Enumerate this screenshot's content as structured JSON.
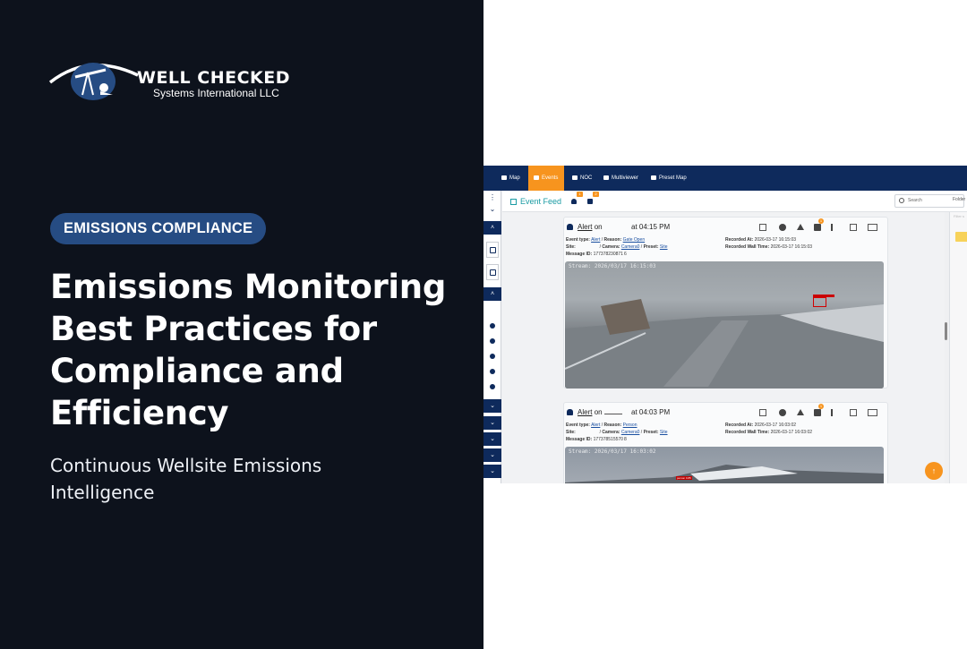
{
  "brand": {
    "name": "WELL CHECKED",
    "subtitle": "Systems International LLC"
  },
  "badge": "EMISSIONS COMPLIANCE",
  "headline": {
    "line1": "Emissions Monitoring",
    "line2": "Best Practices for",
    "line3": "Compliance and",
    "line4": "Efficiency"
  },
  "subline": {
    "line1": "Continuous Wellsite Emissions",
    "line2": "Intelligence"
  },
  "colors": {
    "panel_bg": "#0d121c",
    "badge_bg": "#264c83",
    "app_nav": "#0e2a5c",
    "accent_orange": "#f7941e",
    "feed_teal": "#1a9ba3",
    "detection_red": "#d10000"
  },
  "app": {
    "nav_tabs": [
      {
        "label": "Map",
        "icon": "map-icon",
        "active": false
      },
      {
        "label": "Events",
        "icon": "calendar-icon",
        "active": true
      },
      {
        "label": "NOC",
        "icon": "camera-icon",
        "active": false
      },
      {
        "label": "Multiviewer",
        "icon": "camera-icon",
        "active": false
      },
      {
        "label": "Preset Map",
        "icon": "map-icon",
        "active": false
      }
    ],
    "feed_title": "Event Feed",
    "header_badges": [
      "1",
      "2"
    ],
    "search_placeholder": "Search",
    "folders_label": "Folder",
    "right_panel_hint": "Filter s",
    "scroll_top_icon": "↑",
    "events": [
      {
        "alert_label": "Alert",
        "on_label": "on",
        "time": "at 04:15 PM",
        "event_type": "Alert",
        "reason": "Gate Open",
        "site": "",
        "camera": "Camera0",
        "preset": "Site",
        "message_id": "177378230871 6",
        "recorded_at": "2026-03-17 16:15:03",
        "recorded_wall_time": "2026-03-17 16:15:03",
        "image_timestamp": "Stream: 2026/03/17 16:15:03",
        "notification_count": "1"
      },
      {
        "alert_label": "Alert",
        "on_label": "on",
        "time": "at 04:03 PM",
        "event_type": "Alert",
        "reason": "Person",
        "site": "",
        "camera": "Camera0",
        "preset": "Site",
        "message_id": "177378515570 8",
        "recorded_at": "2026-03-17 16:03:02",
        "recorded_wall_time": "2026-03-17 16:03:02",
        "image_timestamp": "Stream: 2026/03/17 16:03:02",
        "notification_count": "1",
        "detection_label": "person 0.85"
      }
    ],
    "labels": {
      "event_type": "Event type:",
      "reason": "Reason:",
      "site": "Site:",
      "camera": "Camera:",
      "preset": "Preset:",
      "message_id": "Message ID:",
      "recorded_at": "Recorded At:",
      "recorded_wall_time": "Recorded Wall Time:"
    }
  }
}
